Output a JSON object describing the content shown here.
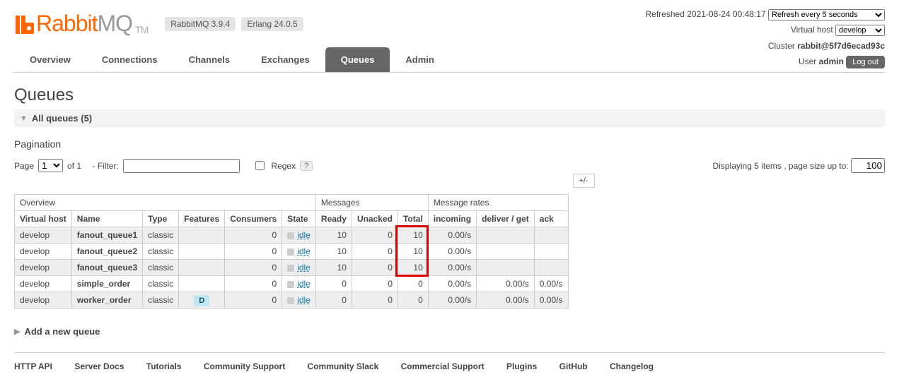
{
  "logo": {
    "brand": "Rabbit",
    "mq": "MQ",
    "tm": "TM"
  },
  "versions": {
    "rabbitmq": "RabbitMQ 3.9.4",
    "erlang": "Erlang 24.0.5"
  },
  "status": {
    "refreshed_label": "Refreshed",
    "refreshed_time": "2021-08-24 00:48:17",
    "refresh_select": "Refresh every 5 seconds",
    "vhost_label": "Virtual host",
    "vhost_value": "develop",
    "cluster_label": "Cluster",
    "cluster_value": "rabbit@5f7d6ecad93c",
    "user_label": "User",
    "user_value": "admin",
    "logout": "Log out"
  },
  "tabs": [
    "Overview",
    "Connections",
    "Channels",
    "Exchanges",
    "Queues",
    "Admin"
  ],
  "page_title": "Queues",
  "section_all": "All queues (5)",
  "pagination": {
    "title": "Pagination",
    "page_label": "Page",
    "page_value": "1",
    "of_text": "of 1",
    "filter_label": "- Filter:",
    "regex_label": "Regex",
    "help": "?",
    "display_text": "Displaying 5 items , page size up to:",
    "page_size": "100"
  },
  "table": {
    "group_headers": [
      "Overview",
      "Messages",
      "Message rates",
      "+/-"
    ],
    "sub_headers": [
      "Virtual host",
      "Name",
      "Type",
      "Features",
      "Consumers",
      "State",
      "Ready",
      "Unacked",
      "Total",
      "incoming",
      "deliver / get",
      "ack"
    ],
    "rows": [
      {
        "vhost": "develop",
        "name": "fanout_queue1",
        "type": "classic",
        "features": "",
        "consumers": "0",
        "state": "idle",
        "ready": "10",
        "unacked": "0",
        "total": "10",
        "incoming": "0.00/s",
        "deliver": "",
        "ack": ""
      },
      {
        "vhost": "develop",
        "name": "fanout_queue2",
        "type": "classic",
        "features": "",
        "consumers": "0",
        "state": "idle",
        "ready": "10",
        "unacked": "0",
        "total": "10",
        "incoming": "0.00/s",
        "deliver": "",
        "ack": ""
      },
      {
        "vhost": "develop",
        "name": "fanout_queue3",
        "type": "classic",
        "features": "",
        "consumers": "0",
        "state": "idle",
        "ready": "10",
        "unacked": "0",
        "total": "10",
        "incoming": "0.00/s",
        "deliver": "",
        "ack": ""
      },
      {
        "vhost": "develop",
        "name": "simple_order",
        "type": "classic",
        "features": "",
        "consumers": "0",
        "state": "idle",
        "ready": "0",
        "unacked": "0",
        "total": "0",
        "incoming": "0.00/s",
        "deliver": "0.00/s",
        "ack": "0.00/s"
      },
      {
        "vhost": "develop",
        "name": "worker_order",
        "type": "classic",
        "features": "D",
        "consumers": "0",
        "state": "idle",
        "ready": "0",
        "unacked": "0",
        "total": "0",
        "incoming": "0.00/s",
        "deliver": "0.00/s",
        "ack": "0.00/s"
      }
    ]
  },
  "add_queue": "Add a new queue",
  "footer": [
    "HTTP API",
    "Server Docs",
    "Tutorials",
    "Community Support",
    "Community Slack",
    "Commercial Support",
    "Plugins",
    "GitHub",
    "Changelog"
  ]
}
